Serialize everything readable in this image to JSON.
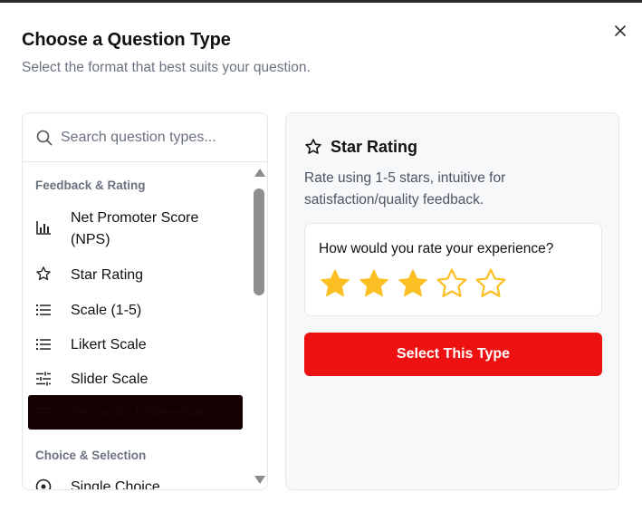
{
  "dialog": {
    "title": "Choose a Question Type",
    "subtitle": "Select the format that best suits your question.",
    "close_icon": "close-icon"
  },
  "search": {
    "placeholder": "Search question types...",
    "value": "",
    "icon": "search-icon"
  },
  "categories": [
    {
      "label": "Feedback & Rating",
      "items": [
        {
          "label_line1": "Net Promoter Score",
          "label_line2": "(NPS)",
          "icon": "bar-chart-icon"
        },
        {
          "label": "Star Rating",
          "icon": "star-outline-icon"
        },
        {
          "label": "Scale (1-5)",
          "icon": "list-icon"
        },
        {
          "label": "Likert Scale",
          "icon": "list-icon"
        },
        {
          "label": "Slider Scale",
          "icon": "sliders-icon"
        },
        {
          "label": "Semantic Differential",
          "icon": "list-icon",
          "selected": true
        }
      ]
    },
    {
      "label": "Choice & Selection",
      "items": [
        {
          "label": "Single Choice",
          "icon": "radio-icon"
        }
      ]
    }
  ],
  "preview": {
    "title": "Star Rating",
    "icon": "star-outline-icon",
    "description": "Rate using 1-5 stars, intuitive for satisfaction/quality feedback.",
    "question": "How would you rate your experience?",
    "rating": 3,
    "max_rating": 5,
    "select_label": "Select This Type"
  },
  "colors": {
    "accent": "#ee1111",
    "star_filled": "#fbbf24",
    "star_outline": "#fbbf24",
    "selected_item_bg": "#140202",
    "muted_text": "#6b7280"
  }
}
